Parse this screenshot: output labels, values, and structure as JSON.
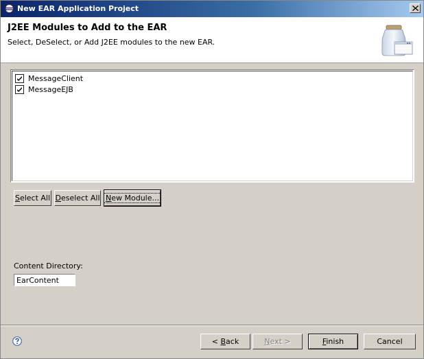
{
  "window": {
    "title": "New EAR Application Project",
    "close_glyph": "✕"
  },
  "header": {
    "title": "J2EE Modules to Add to the EAR",
    "description": "Select, DeSelect, or Add J2EE modules to the new EAR.",
    "art_icon": "jar-window-icon"
  },
  "modules": [
    {
      "label": "MessageClient",
      "checked": true
    },
    {
      "label": "MessageEJB",
      "checked": true
    }
  ],
  "module_buttons": {
    "select_all_pre": "",
    "select_all_u": "S",
    "select_all_post": "elect All",
    "deselect_all_pre": "",
    "deselect_all_u": "D",
    "deselect_all_post": "eselect All",
    "new_module_pre": "",
    "new_module_u": "N",
    "new_module_post": "ew Module..."
  },
  "content_directory": {
    "label": "Content Directory:",
    "value": "EarContent"
  },
  "footer": {
    "back_pre": "< ",
    "back_u": "B",
    "back_post": "ack",
    "next_pre": "",
    "next_u": "N",
    "next_post": "ext >",
    "finish_pre": "",
    "finish_u": "F",
    "finish_post": "inish",
    "cancel": "Cancel",
    "next_enabled": false
  }
}
